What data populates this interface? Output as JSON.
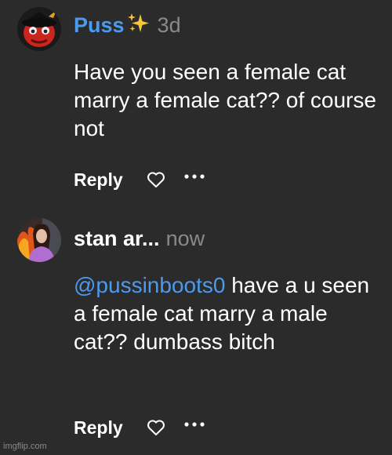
{
  "comments": [
    {
      "username": "Puss",
      "username_suffix_icon": "sparkles-icon",
      "time": "3d",
      "avatar_icon": "red-character-avatar",
      "body": "Have you seen a female cat marry a female cat?? of course not",
      "actions": {
        "reply_label": "Reply",
        "like_icon": "heart-outline-icon",
        "more_icon": "ellipsis-icon"
      }
    },
    {
      "username": "stan ar...",
      "time": "now",
      "avatar_icon": "woman-fire-avatar",
      "mention": "@pussinboots0",
      "body": " have a u seen a female cat marry a male cat?? dumbass bitch",
      "actions": {
        "reply_label": "Reply",
        "like_icon": "heart-outline-icon",
        "more_icon": "ellipsis-icon"
      }
    }
  ],
  "watermark": "imgflip.com",
  "colors": {
    "background": "#2b2b2b",
    "link_blue": "#4a9bf0",
    "muted_gray": "#8a8a8a",
    "text_white": "#ffffff"
  }
}
